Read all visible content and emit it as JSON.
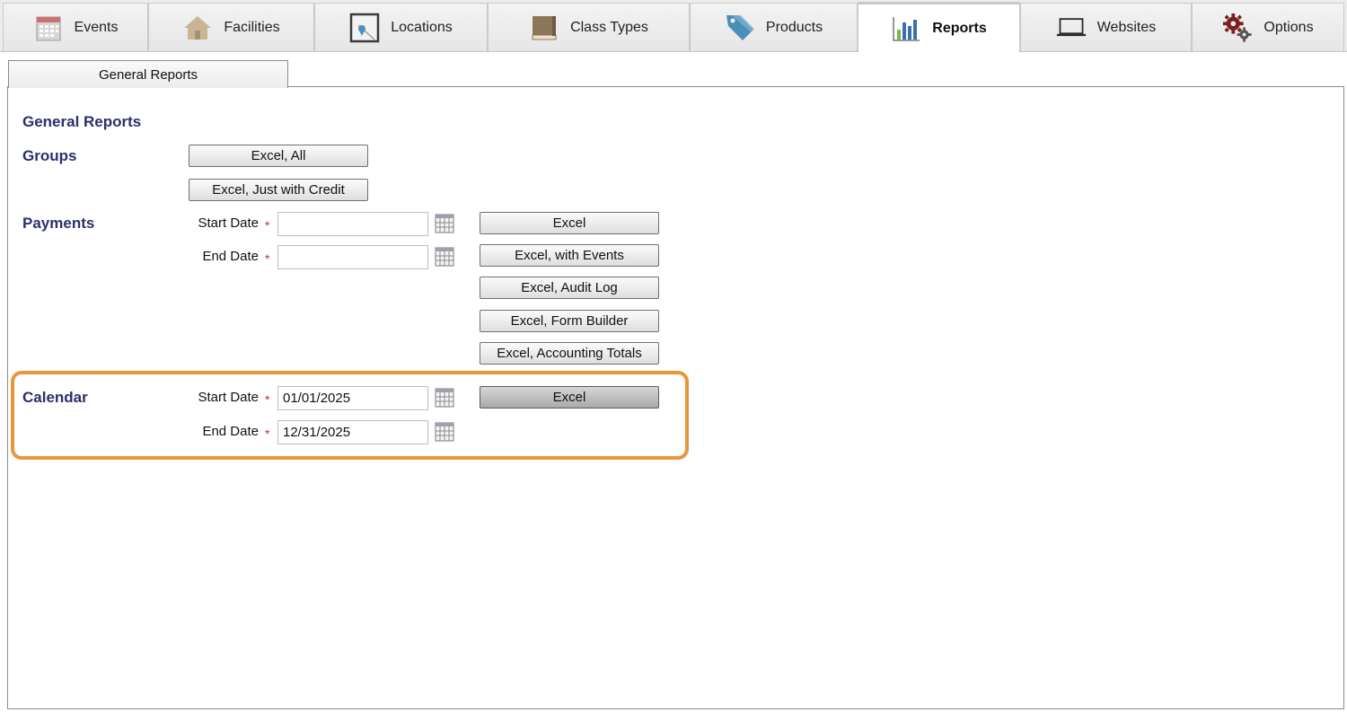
{
  "nav": {
    "tabs": [
      {
        "id": "events",
        "label": "Events",
        "icon": "calendar-grid-icon"
      },
      {
        "id": "facilities",
        "label": "Facilities",
        "icon": "house-icon"
      },
      {
        "id": "locations",
        "label": "Locations",
        "icon": "map-pin-frame-icon"
      },
      {
        "id": "class_types",
        "label": "Class Types",
        "icon": "book-icon"
      },
      {
        "id": "products",
        "label": "Products",
        "icon": "price-tag-icon"
      },
      {
        "id": "reports",
        "label": "Reports",
        "icon": "bar-chart-icon",
        "active": true
      },
      {
        "id": "websites",
        "label": "Websites",
        "icon": "laptop-icon"
      },
      {
        "id": "options",
        "label": "Options",
        "icon": "gears-icon"
      }
    ]
  },
  "subtabs": {
    "general_reports": "General Reports"
  },
  "page": {
    "title": "General Reports"
  },
  "groups": {
    "title": "Groups",
    "buttons": {
      "excel_all": "Excel, All",
      "excel_credit": "Excel, Just with Credit"
    }
  },
  "payments": {
    "title": "Payments",
    "start_label": "Start Date",
    "end_label": "End Date",
    "start_value": "",
    "end_value": "",
    "buttons": {
      "excel": "Excel",
      "excel_events": "Excel, with Events",
      "excel_audit": "Excel, Audit Log",
      "excel_form": "Excel, Form Builder",
      "excel_totals": "Excel, Accounting Totals"
    }
  },
  "calendar": {
    "title": "Calendar",
    "start_label": "Start Date",
    "end_label": "End Date",
    "start_value": "01/01/2025",
    "end_value": "12/31/2025",
    "buttons": {
      "excel": "Excel"
    }
  },
  "required_mark": "*",
  "colors": {
    "section_title": "#2b2f6b",
    "required": "#cc2a2a",
    "highlight": "#e8963a"
  }
}
